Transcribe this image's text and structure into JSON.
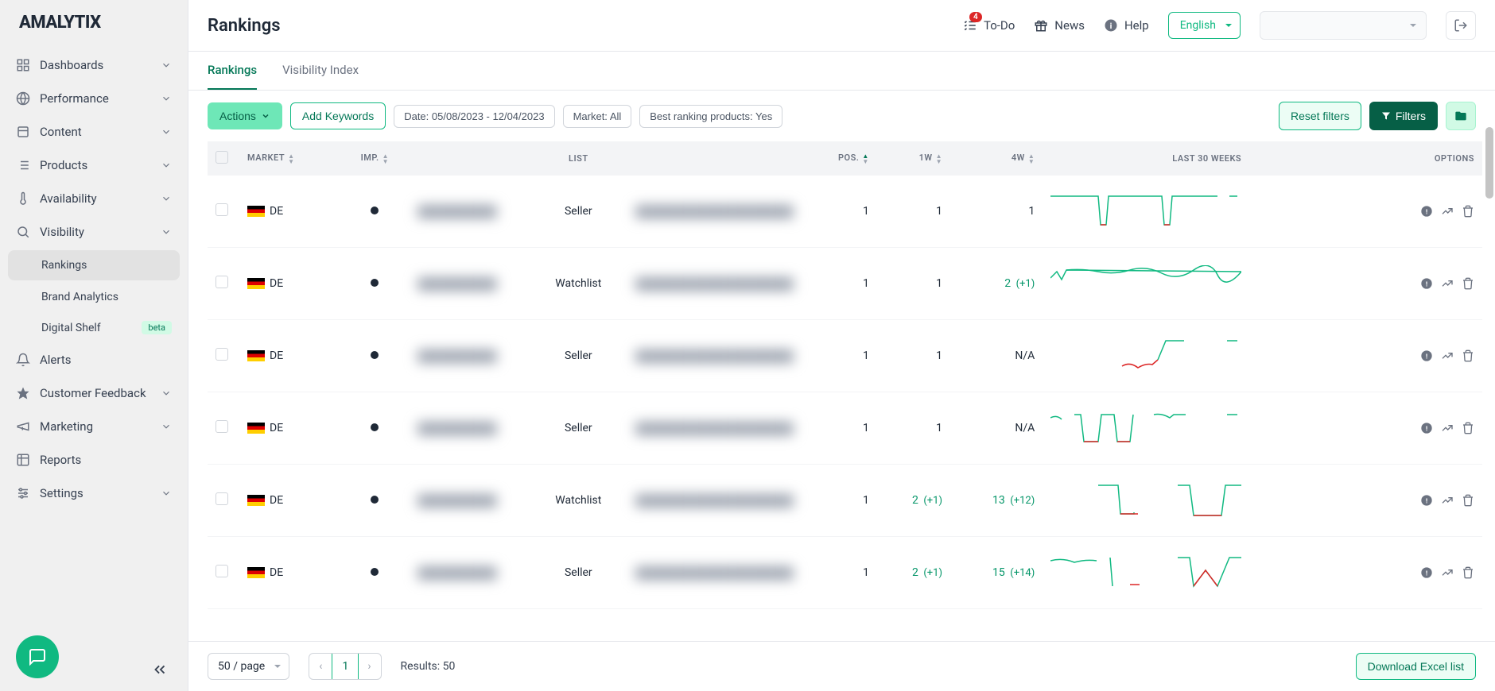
{
  "logo": "AMALYTIX",
  "page_title": "Rankings",
  "topbar": {
    "todo": "To-Do",
    "todo_badge": "4",
    "news": "News",
    "help": "Help",
    "language": "English"
  },
  "sidebar": {
    "items": [
      {
        "label": "Dashboards",
        "icon": "grid"
      },
      {
        "label": "Performance",
        "icon": "globe"
      },
      {
        "label": "Content",
        "icon": "layers"
      },
      {
        "label": "Products",
        "icon": "list"
      },
      {
        "label": "Availability",
        "icon": "thermometer"
      },
      {
        "label": "Visibility",
        "icon": "search",
        "expanded": true,
        "children": [
          {
            "label": "Rankings",
            "active": true
          },
          {
            "label": "Brand Analytics"
          },
          {
            "label": "Digital Shelf",
            "badge": "beta"
          }
        ]
      },
      {
        "label": "Alerts",
        "icon": "bell"
      },
      {
        "label": "Customer Feedback",
        "icon": "star"
      },
      {
        "label": "Marketing",
        "icon": "megaphone"
      },
      {
        "label": "Reports",
        "icon": "table"
      },
      {
        "label": "Settings",
        "icon": "sliders"
      }
    ]
  },
  "tabs": [
    {
      "label": "Rankings",
      "active": true
    },
    {
      "label": "Visibility Index"
    }
  ],
  "toolbar": {
    "actions": "Actions",
    "add_keywords": "Add Keywords",
    "date_filter": "Date: 05/08/2023 - 12/04/2023",
    "market_filter": "Market: All",
    "best_ranking_filter": "Best ranking products: Yes",
    "reset_filters": "Reset filters",
    "filters": "Filters"
  },
  "table": {
    "headers": {
      "market": "MARKET",
      "imp": "IMP.",
      "list": "LIST",
      "pos": "POS.",
      "w1": "1W",
      "w4": "4W",
      "last30": "LAST 30 WEEKS",
      "options": "OPTIONS"
    },
    "rows": [
      {
        "market": "DE",
        "list": "Seller",
        "pos": "1",
        "w1": "1",
        "w4": "1",
        "w4_delta": ""
      },
      {
        "market": "DE",
        "list": "Watchlist",
        "pos": "1",
        "w1": "1",
        "w4": "2",
        "w4_delta": "(+1)"
      },
      {
        "market": "DE",
        "list": "Seller",
        "pos": "1",
        "w1": "1",
        "w4": "N/A",
        "w4_delta": ""
      },
      {
        "market": "DE",
        "list": "Seller",
        "pos": "1",
        "w1": "1",
        "w4": "N/A",
        "w4_delta": ""
      },
      {
        "market": "DE",
        "list": "Watchlist",
        "pos": "1",
        "w1": "2",
        "w1_delta": "(+1)",
        "w4": "13",
        "w4_delta": "(+12)"
      },
      {
        "market": "DE",
        "list": "Seller",
        "pos": "1",
        "w1": "2",
        "w1_delta": "(+1)",
        "w4": "15",
        "w4_delta": "(+14)"
      }
    ]
  },
  "footer": {
    "page_size": "50 / page",
    "current_page": "1",
    "results": "Results: 50",
    "download": "Download Excel list"
  },
  "chart_data": [
    {
      "type": "line",
      "note": "row 1 sparkline - flat at rank 1 with two dips",
      "values_green": [
        1,
        1,
        1,
        1,
        1,
        1,
        1,
        1,
        1,
        1,
        1,
        1,
        1,
        1,
        1,
        1,
        1,
        1,
        1,
        1,
        1,
        1,
        1,
        1,
        1,
        1,
        1,
        1,
        1,
        1
      ],
      "dips_red": [
        [
          6,
          7
        ],
        [
          20,
          21
        ]
      ],
      "gap_green": [
        [
          28,
          29
        ]
      ]
    },
    {
      "type": "line",
      "note": "row 2 sparkline - wavy near rank 1",
      "values_green": [
        3,
        2,
        2,
        1,
        2,
        1,
        2,
        1,
        2,
        1,
        2,
        2,
        1,
        2,
        1,
        2,
        1,
        2,
        1,
        2,
        1,
        2,
        1,
        2,
        1,
        2,
        3,
        2,
        1,
        2
      ]
    },
    {
      "type": "line",
      "note": "row 3 sparkline - red declining then green spike up then flat",
      "red_segment": [
        30,
        28,
        32,
        30,
        33,
        28,
        30,
        26
      ],
      "green_segment": [
        26,
        2,
        1,
        1
      ],
      "gap_after": true
    },
    {
      "type": "line",
      "note": "row 4 sparkline - multiple green peaks with red valleys",
      "mixed": true
    },
    {
      "type": "line",
      "note": "row 5 sparkline - green flat with red dip, then separate green dip segment",
      "seg1_green": [
        1,
        1,
        1,
        1,
        1,
        1,
        1
      ],
      "seg1_red": [
        30,
        30
      ],
      "seg2_green_vshape": [
        1,
        30,
        30,
        30,
        1
      ]
    },
    {
      "type": "line",
      "note": "row 6 sparkline - wavy green short, then red drops, then green u-shape",
      "mixed": true
    }
  ]
}
